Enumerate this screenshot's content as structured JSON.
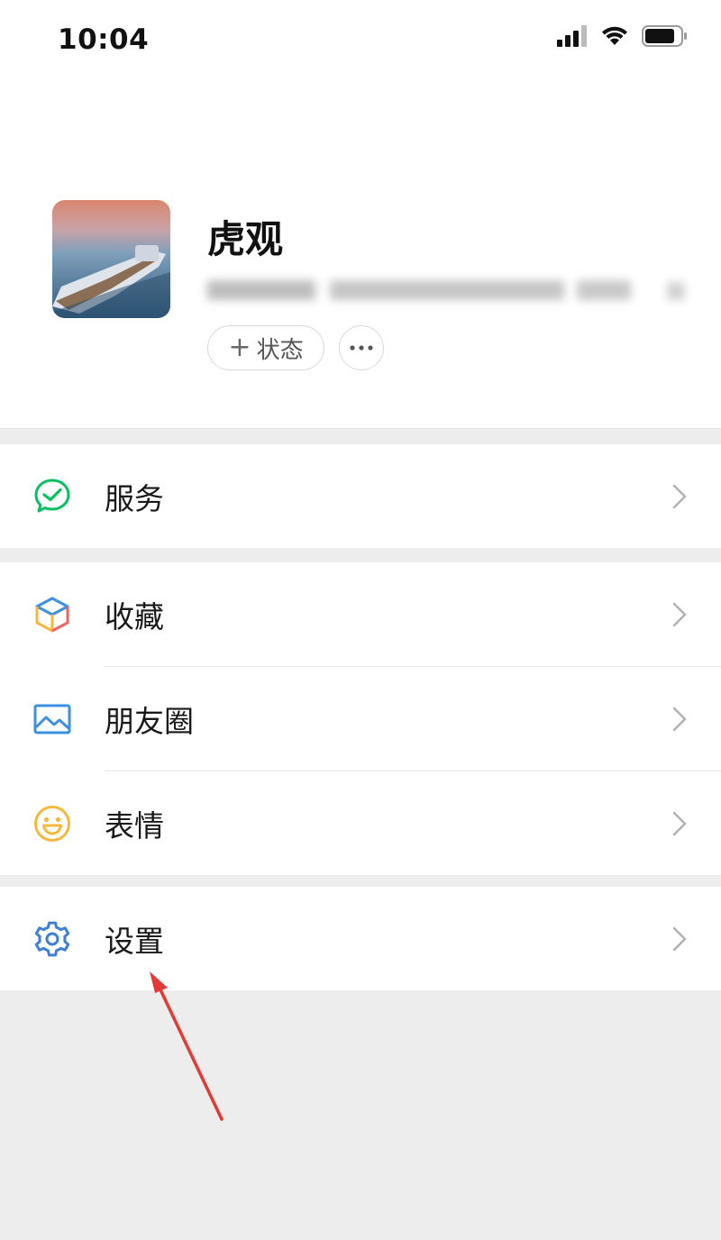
{
  "status_bar": {
    "time": "10:04"
  },
  "profile": {
    "nickname": "虎观",
    "wechat_id": "",
    "status_button_label": "状态",
    "status_button_plus": "+"
  },
  "menu": {
    "services": {
      "label": "服务",
      "icon": "check-bubble-icon"
    },
    "favorites": {
      "label": "收藏",
      "icon": "cube-icon"
    },
    "moments": {
      "label": "朋友圈",
      "icon": "picture-icon"
    },
    "stickers": {
      "label": "表情",
      "icon": "smiley-icon"
    },
    "settings": {
      "label": "设置",
      "icon": "gear-icon"
    }
  },
  "colors": {
    "background": "#ededed",
    "accent_green": "#07c160",
    "annotation_arrow": "#e53935",
    "settings_blue": "#3d7fd8"
  }
}
